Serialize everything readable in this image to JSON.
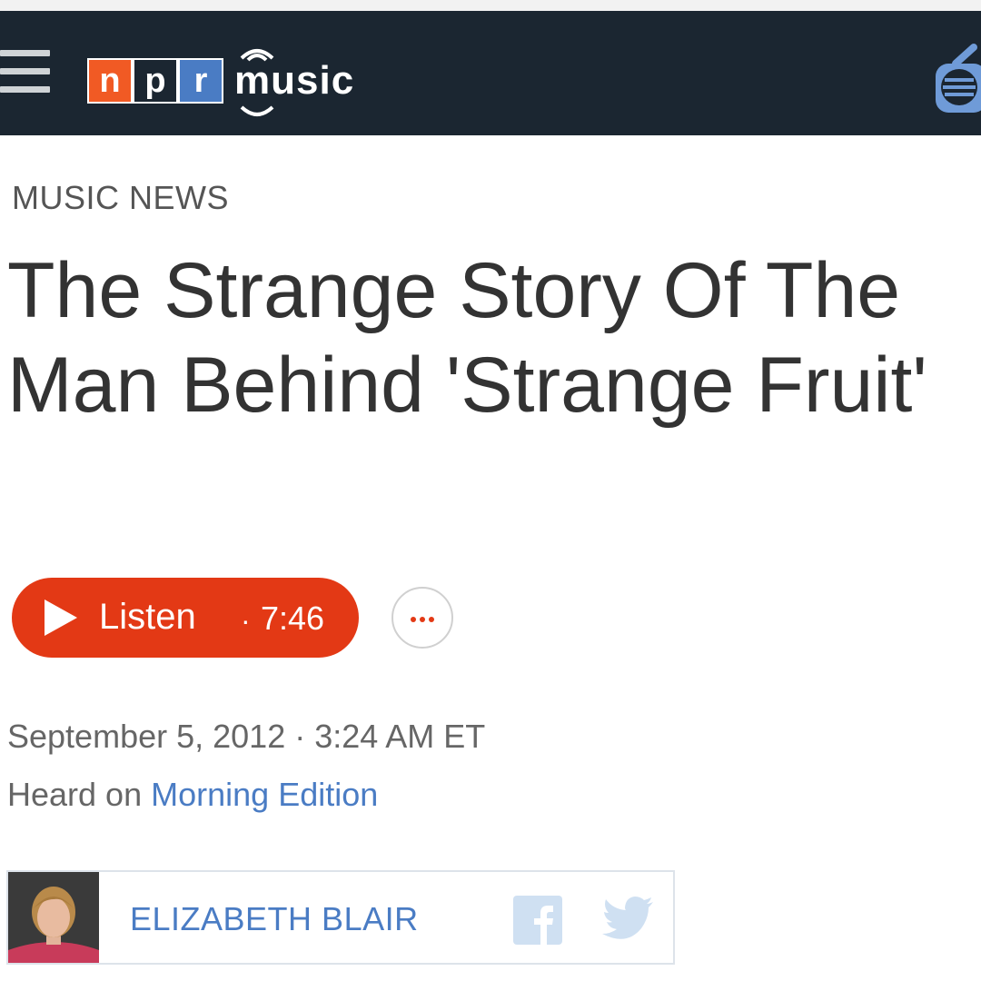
{
  "header": {
    "logo_letters": [
      "n",
      "p",
      "r"
    ],
    "logo_music": "music",
    "menu_icon": "hamburger-menu-icon",
    "radio_icon": "radio-icon"
  },
  "article": {
    "kicker": "MUSIC NEWS",
    "title": "The Strange Story Of The Man Behind 'Strange Fruit'",
    "listen": {
      "label": "Listen",
      "separator": "·",
      "duration": "7:46"
    },
    "more_icon": "more-options-icon",
    "date": "September 5, 2012 · 3:24 AM ET",
    "heard_prefix": "Heard on",
    "program": "Morning Edition",
    "author": "ELIZABETH BLAIR",
    "share_icons": [
      "facebook-icon",
      "twitter-icon"
    ]
  },
  "colors": {
    "nav_bg": "#1b2631",
    "listen_red": "#e33915",
    "link_blue": "#4a7cc4",
    "npr_orange": "#f15a24",
    "npr_blue": "#4a7cc4"
  }
}
